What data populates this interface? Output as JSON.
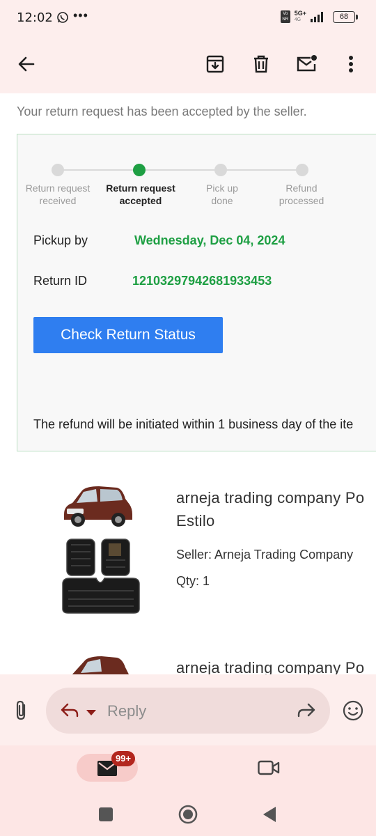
{
  "status_bar": {
    "time": "12:02",
    "network": "5G+",
    "network_sub": "4G",
    "battery": "68"
  },
  "toolbar": {
    "icons": [
      "back-arrow-icon",
      "archive-icon",
      "trash-icon",
      "mark-unread-icon",
      "more-vert-icon"
    ]
  },
  "email": {
    "intro": "Your return request has been accepted by the seller.",
    "tracker": {
      "steps": [
        {
          "line1": "Return request",
          "line2": "received",
          "active": false
        },
        {
          "line1": "Return request",
          "line2": "accepted",
          "active": true
        },
        {
          "line1": "Pick up",
          "line2": "done",
          "active": false
        },
        {
          "line1": "Refund",
          "line2": "processed",
          "active": false
        }
      ],
      "progress_fraction": 0.5
    },
    "pickup_label": "Pickup by",
    "pickup_value": "Wednesday, Dec 04, 2024",
    "return_id_label": "Return ID",
    "return_id_value": "12103297942681933453",
    "cta_label": "Check Return Status",
    "refund_note": "The refund will be initiated within 1 business day of the ite",
    "items": [
      {
        "title_line1": "arneja trading company Po",
        "title_line2": "Estilo",
        "seller": "Seller: Arneja Trading Company",
        "qty": "Qty: 1"
      },
      {
        "title_line1": "arneja trading company Po"
      }
    ]
  },
  "reply_bar": {
    "placeholder": "Reply"
  },
  "bottom_nav": {
    "mail_badge": "99+"
  },
  "colors": {
    "accent_green": "#1e9f43",
    "button_blue": "#2f7ef0",
    "header_bg": "#fdeeed",
    "badge_red": "#b3261e"
  }
}
